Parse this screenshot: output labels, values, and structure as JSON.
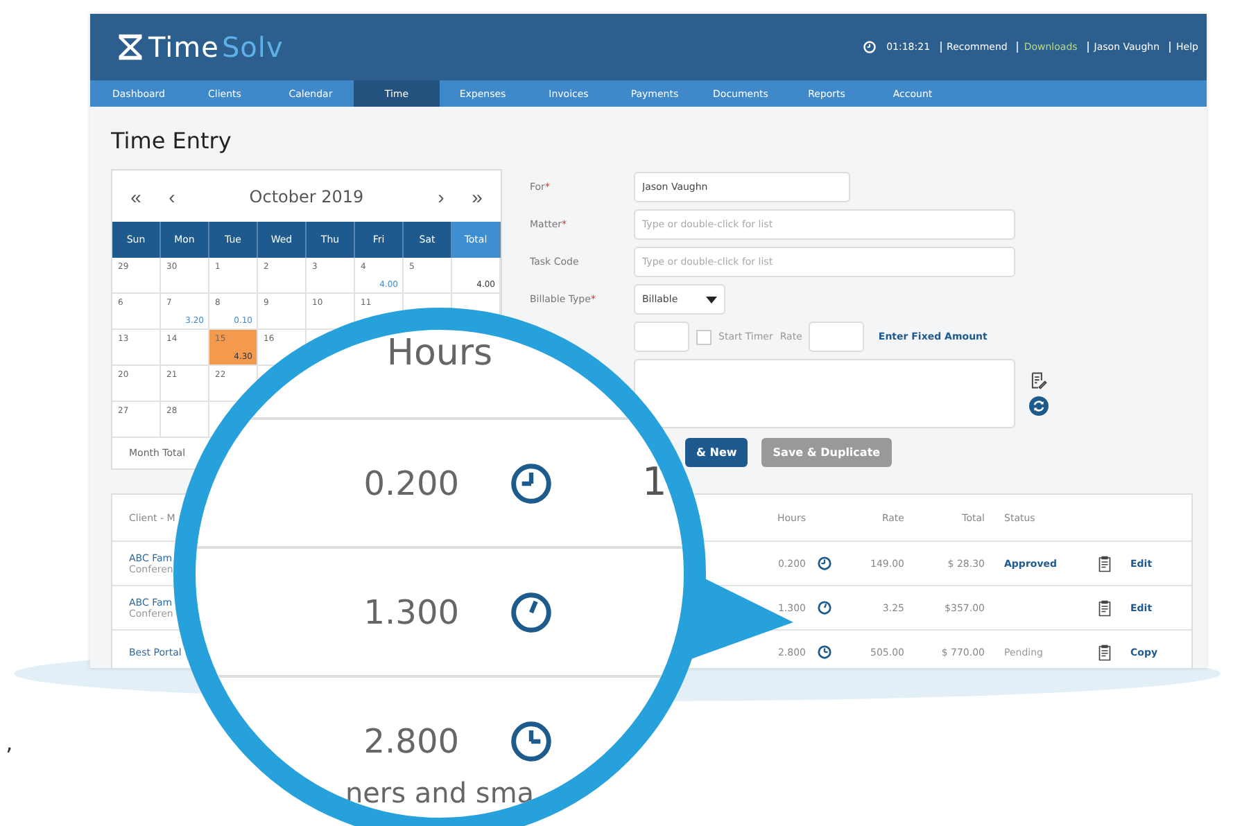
{
  "left_mark": "’",
  "header": {
    "logo": {
      "word1": "Time",
      "word2": "Solv"
    },
    "clock": "01:18:21",
    "links": [
      {
        "label": "Recommend",
        "highlighted": false
      },
      {
        "label": "Downloads",
        "highlighted": true
      },
      {
        "label": "Jason Vaughn",
        "highlighted": false
      },
      {
        "label": "Help",
        "highlighted": false
      }
    ]
  },
  "nav": [
    {
      "label": "Dashboard",
      "selected": false
    },
    {
      "label": "Clients",
      "selected": false
    },
    {
      "label": "Calendar",
      "selected": false
    },
    {
      "label": "Time",
      "selected": true
    },
    {
      "label": "Expenses",
      "selected": false
    },
    {
      "label": "Invoices",
      "selected": false
    },
    {
      "label": "Payments",
      "selected": false
    },
    {
      "label": "Documents",
      "selected": false
    },
    {
      "label": "Reports",
      "selected": false
    },
    {
      "label": "Account",
      "selected": false
    }
  ],
  "page_title": "Time Entry",
  "calendar": {
    "prev_year": "«",
    "prev": "‹",
    "month": "October 2019",
    "next": "›",
    "next_year": "»",
    "weekdays": [
      "Sun",
      "Mon",
      "Tue",
      "Wed",
      "Thu",
      "Fri",
      "Sat",
      "Total"
    ],
    "weeks": [
      [
        {
          "day": "29",
          "selected": false
        },
        {
          "day": "30",
          "selected": false
        },
        {
          "day": "1",
          "selected": false
        },
        {
          "day": "2",
          "selected": false
        },
        {
          "day": "3",
          "selected": false
        },
        {
          "day": "4",
          "hours": "4.00",
          "selected": false
        },
        {
          "day": "5",
          "selected": false
        },
        {
          "hours": "4.00",
          "selected": false
        }
      ],
      [
        {
          "day": "6",
          "selected": false
        },
        {
          "day": "7",
          "hours": "3.20",
          "selected": false
        },
        {
          "day": "8",
          "hours": "0.10",
          "selected": false
        },
        {
          "day": "9",
          "selected": false
        },
        {
          "day": "10",
          "selected": false
        },
        {
          "day": "11",
          "selected": false
        }
      ],
      [
        {
          "day": "13",
          "selected": false
        },
        {
          "day": "14",
          "selected": false
        },
        {
          "day": "15",
          "hours": "4.30",
          "selected": true
        },
        {
          "day": "16",
          "selected": false
        }
      ],
      [
        {
          "day": "20",
          "selected": false
        },
        {
          "day": "21",
          "selected": false
        },
        {
          "day": "22",
          "selected": false
        }
      ],
      [
        {
          "day": "27",
          "selected": false
        },
        {
          "day": "28",
          "selected": false
        }
      ]
    ],
    "month_total_label": "Month Total"
  },
  "form": [
    {
      "kind": "text",
      "label": "For",
      "mark": "*",
      "value": "Jason Vaughn"
    },
    {
      "kind": "wide",
      "label": "Matter",
      "mark": "*",
      "placeholder": "Type or double-click for list"
    },
    {
      "kind": "wide",
      "label": "Task Code",
      "placeholder": "Type or double-click for list"
    },
    {
      "kind": "select",
      "label": "Billable Type",
      "mark": "*",
      "value": "Billable"
    },
    {
      "kind": "hours",
      "timer_label": "Start Timer",
      "timer_checked": false,
      "rate_label": "Rate",
      "link": "Enter Fixed Amount"
    },
    {
      "kind": "textarea"
    }
  ],
  "buttons": [
    {
      "label": "& New",
      "kind": "primary"
    },
    {
      "label": "Save & Duplicate",
      "kind": "disabled"
    }
  ],
  "table": {
    "columns": [
      "Client - M",
      "Hours",
      "Rate",
      "Total",
      "Status"
    ],
    "rows": [
      {
        "client": "ABC Fam",
        "subtitle": "Conferen",
        "hours": "0.200",
        "rate": "149.00",
        "total": "$ 28.30",
        "status": "Approved",
        "status_highlighted": true,
        "action": "Edit"
      },
      {
        "client": "ABC Fam",
        "subtitle": "Conferen",
        "hours": "1.300",
        "rate": "3.25",
        "total": "$357.00",
        "action": "Edit"
      },
      {
        "client": "Best Portal",
        "hours": "2.800",
        "rate": "505.00",
        "total": "$ 770.00",
        "status": "Pending",
        "status_highlighted": false,
        "action": "Copy"
      }
    ]
  },
  "magnifier": {
    "heading": "Hours",
    "values": [
      "0.200",
      "1.300",
      "2.800"
    ],
    "side_text": "1",
    "caption": "ners and sma"
  }
}
